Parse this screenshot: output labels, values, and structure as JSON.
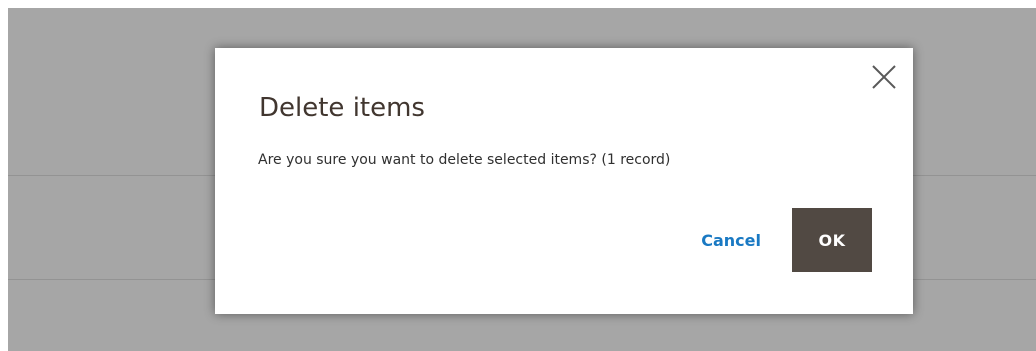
{
  "modal": {
    "title": "Delete items",
    "message": "Are you sure you want to delete selected items? (1 record)",
    "close_icon": "close-icon",
    "buttons": {
      "cancel": "Cancel",
      "ok": "OK"
    }
  },
  "colors": {
    "overlay": "#a6a6a6",
    "title": "#41362f",
    "link": "#1979c3",
    "primary_button": "#514943"
  }
}
